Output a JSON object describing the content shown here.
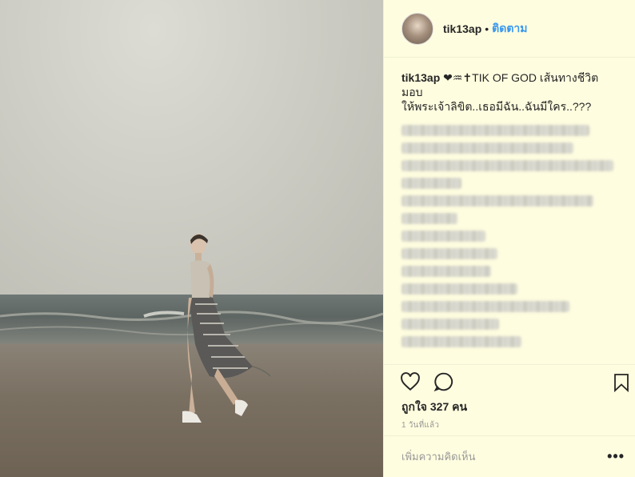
{
  "header": {
    "username": "tik13ap",
    "dot": "•",
    "follow_label": "ติดตาม"
  },
  "caption": {
    "username": "tik13ap",
    "text_line1": "❤♒✝TIK OF GOD เส้นทางชีวิตมอบ",
    "text_line2": "ให้พระเจ้าลิขิต..เธอมีฉัน..ฉันมีใคร..???"
  },
  "actions": {
    "likes": "ถูกใจ 327 คน",
    "time": "1 วันที่แล้ว"
  },
  "comment": {
    "placeholder": "เพิ่มความคิดเห็น",
    "more": "•••"
  },
  "colors": {
    "side_bg": "#fffddf",
    "follow": "#3897f0",
    "text": "#262626",
    "muted": "#999999"
  },
  "icons": [
    "heart-icon",
    "comment-icon",
    "bookmark-icon",
    "more-options-icon"
  ]
}
